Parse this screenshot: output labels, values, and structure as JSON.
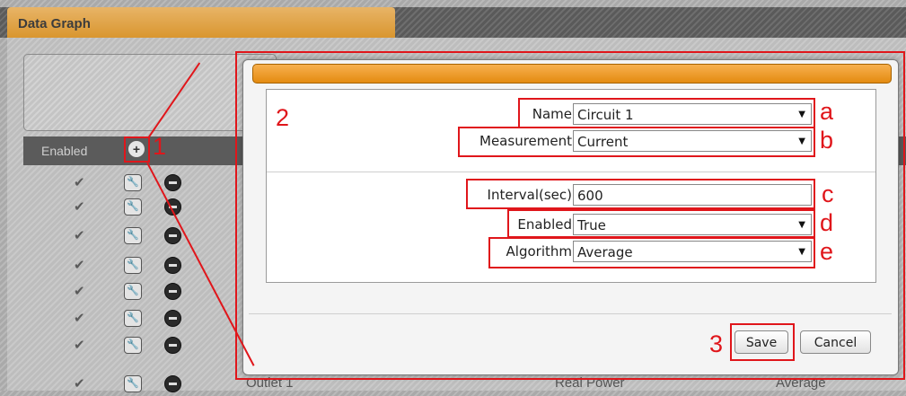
{
  "page_title": "Data Graph",
  "table": {
    "header_enabled": "Enabled",
    "rows": [
      {
        "enabled": "✔"
      },
      {
        "enabled": "✔"
      },
      {
        "enabled": "✔"
      },
      {
        "enabled": "✔"
      },
      {
        "enabled": "✔"
      },
      {
        "enabled": "✔"
      },
      {
        "enabled": "✔"
      },
      {
        "enabled": "✔",
        "outlet": "Outlet 1",
        "measurement": "Real Power",
        "algorithm": "Average"
      }
    ]
  },
  "dialog": {
    "fields": {
      "name": {
        "label": "Name",
        "value": "Circuit 1",
        "type": "select"
      },
      "measurement": {
        "label": "Measurement",
        "value": "Current",
        "type": "select"
      },
      "interval": {
        "label": "Interval(sec)",
        "value": "600",
        "type": "text"
      },
      "enabled": {
        "label": "Enabled",
        "value": "True",
        "type": "select"
      },
      "algorithm": {
        "label": "Algorithm",
        "value": "Average",
        "type": "select"
      }
    },
    "save_label": "Save",
    "cancel_label": "Cancel"
  },
  "annotations": {
    "n1": "1",
    "n2": "2",
    "n3": "3",
    "a": "a",
    "b": "b",
    "c": "c",
    "d": "d",
    "e": "e"
  },
  "icons": {
    "add": "plus-circle-icon",
    "edit": "wrench-icon",
    "delete": "minus-circle-icon",
    "check": "checkmark-icon",
    "dropdown": "caret-down-icon"
  },
  "colors": {
    "accent_orange": "#e48b10",
    "annotation_red": "#e0161b",
    "table_header": "#5b5b5b"
  }
}
